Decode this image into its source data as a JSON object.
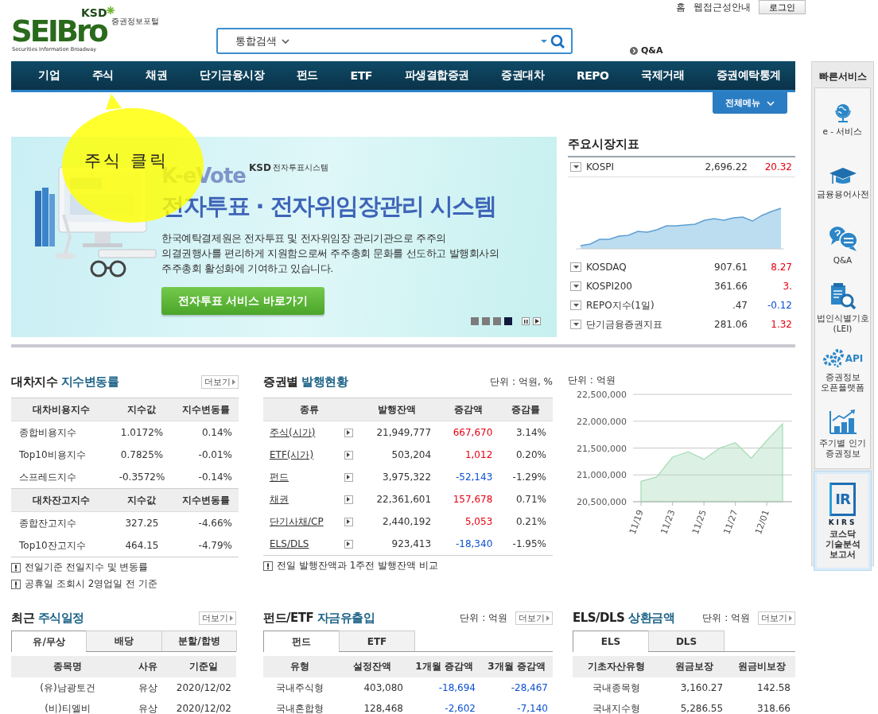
{
  "header": {
    "logo_main": "SEIBro",
    "logo_ksd": "KSD",
    "logo_portal": "증권정보포털",
    "logo_tagline": "Securities Information Broadway",
    "top_links": [
      "홈",
      "웹접근성안내"
    ],
    "login_button": "로그인",
    "search": {
      "scope": "통합검색"
    },
    "qna_link": "Q&A"
  },
  "nav": {
    "items": [
      "기업",
      "주식",
      "채권",
      "단기금융시장",
      "펀드",
      "ETF",
      "파생결합증권",
      "증권대차",
      "REPO",
      "국제거래",
      "증권예탁통계"
    ],
    "all_menu": "전체메뉴"
  },
  "callout": {
    "text": "주식 클릭"
  },
  "banner": {
    "brand": "K-eVote",
    "ksd": "KSD",
    "system": "전자투표시스템",
    "title": "전자투표 · 전자위임장관리 시스템",
    "body_lines": [
      "한국예탁결제원은 전자투표 및 전자위임장 관리기관으로 주주의",
      "의결권행사를 편리하게 지원함으로써 주주총회 문화를 선도하고 발행회사의",
      "주주총회 활성화에 기여하고 있습니다."
    ],
    "button": "전자투표 서비스 바로가기",
    "pager": [
      {
        "selected": false
      },
      {
        "selected": false
      },
      {
        "selected": false
      },
      {
        "selected": true
      }
    ]
  },
  "market": {
    "title": "주요시장지표",
    "rows": [
      {
        "name": "KOSPI",
        "value": "2,696.22",
        "change": "20.32",
        "falling": false
      },
      {
        "name": "KOSDAQ",
        "value": "907.61",
        "change": "8.27",
        "falling": false
      },
      {
        "name": "KOSPI200",
        "value": "361.66",
        "change": "3.",
        "falling": false
      },
      {
        "name": "REPO지수(1일)",
        "value": ".47",
        "change": "-0.12",
        "falling": true
      },
      {
        "name": "단기금융증권지표",
        "value": "281.06",
        "change": "1.32",
        "falling": false
      }
    ]
  },
  "lending": {
    "title_plain": "대차지수",
    "title_accent": "지수변동률",
    "more": "더보기",
    "groups": [
      {
        "columns": [
          "대차비용지수",
          "지수값",
          "지수변동률"
        ],
        "rows": [
          [
            "종합비용지수",
            "1.0172%",
            "0.14%"
          ],
          [
            "Top10비용지수",
            "0.7825%",
            "-0.01%"
          ],
          [
            "스프레드지수",
            "-0.3572%",
            "-0.14%"
          ]
        ]
      },
      {
        "columns": [
          "대차잔고지수",
          "지수값",
          "지수변동률"
        ],
        "rows": [
          [
            "종합잔고지수",
            "327.25",
            "-4.66%"
          ],
          [
            "Top10잔고지수",
            "464.15",
            "-4.79%"
          ]
        ]
      }
    ],
    "notes": [
      "전일기준 전일지수 및 변동률",
      "공휴일 조회시 2영업일 전 기준"
    ]
  },
  "issuance": {
    "title_plain": "증권별",
    "title_accent": "발행현황",
    "unit": "단위 : 억원, %",
    "columns": [
      "종류",
      "발행잔액",
      "증감액",
      "증감률"
    ],
    "rows": [
      {
        "name": "주식(시가)",
        "balance": "21,949,777",
        "change": "667,670",
        "rate": "3.14%",
        "falling": false
      },
      {
        "name": "ETF(시가)",
        "balance": "503,204",
        "change": "1,012",
        "rate": "0.20%",
        "falling": false
      },
      {
        "name": "펀드",
        "balance": "3,975,322",
        "change": "-52,143",
        "rate": "-1.29%",
        "falling": true
      },
      {
        "name": "채권",
        "balance": "22,361,601",
        "change": "157,678",
        "rate": "0.71%",
        "falling": false
      },
      {
        "name": "단기사채/CP",
        "balance": "2,440,192",
        "change": "5,053",
        "rate": "0.21%",
        "falling": false
      },
      {
        "name": "ELS/DLS",
        "balance": "923,413",
        "change": "-18,340",
        "rate": "-1.95%",
        "falling": true
      }
    ],
    "note": "전일 발행잔액과 1주전 발행잔액 비교"
  },
  "issuance_chart": {
    "unit": "단위 : 억원",
    "chart_data": {
      "type": "area",
      "categories": [
        "11/19",
        null,
        "11/23",
        null,
        "11/25",
        null,
        "11/27",
        null,
        "12/01",
        null
      ],
      "series": [
        {
          "color": "#a8dcb8",
          "values": [
            20880000,
            20960000,
            21330000,
            21430000,
            21290000,
            21500000,
            21600000,
            21310000,
            21640000,
            21950000
          ]
        }
      ],
      "ylim": [
        20500000,
        22500000
      ],
      "grid": true,
      "yticks": [
        {
          "value": 20500000,
          "label": "20,500,000"
        },
        {
          "value": 21000000,
          "label": "21,000,000"
        },
        {
          "value": 21500000,
          "label": "21,500,000"
        },
        {
          "value": 22000000,
          "label": "22,000,000"
        },
        {
          "value": 22500000,
          "label": "22,500,000"
        }
      ]
    }
  },
  "quick_service": {
    "title": "빠른서비스",
    "items": [
      {
        "kind": "globe",
        "label_lines": [
          "e - 서비스"
        ],
        "highlighted": false
      },
      {
        "kind": "cap",
        "label_lines": [
          "금융용어사전"
        ],
        "highlighted": false
      },
      {
        "kind": "qna",
        "label_lines": [
          "Q&A"
        ],
        "highlighted": false
      },
      {
        "kind": "lei",
        "label_lines": [
          "법인식별기호",
          "(LEI)"
        ],
        "highlighted": false
      },
      {
        "kind": "api",
        "badge": "API",
        "label_lines": [
          "증권정보",
          "오픈플랫폼"
        ],
        "highlighted": false
      },
      {
        "kind": "trend",
        "label_lines": [
          "주기별 인기",
          "증권정보"
        ],
        "highlighted": false
      },
      {
        "kind": "kirs",
        "logo": "IR",
        "badge": "KIRS",
        "label_lines": [
          "코스닥",
          "기술분석",
          "보고서"
        ],
        "highlighted": true
      }
    ]
  },
  "schedule": {
    "title_plain": "최근",
    "title_accent": "주식일정",
    "more": "더보기",
    "tabs": [
      {
        "label": "유/무상",
        "selected": true
      },
      {
        "label": "배당",
        "selected": false
      },
      {
        "label": "분할/합병",
        "selected": false
      }
    ],
    "columns": [
      "종목명",
      "사유",
      "기준일"
    ],
    "rows": [
      {
        "cells": [
          "(유)남광토건",
          "유상",
          "2020/12/02"
        ]
      },
      {
        "cells": [
          "(비)티엘비",
          "유상",
          "2020/12/02"
        ]
      }
    ]
  },
  "fund_flow": {
    "title_plain": "펀드/ETF",
    "title_accent": "자금유출입",
    "unit": "단위 : 억원",
    "more": "더보기",
    "tabs": [
      {
        "label": "펀드",
        "selected": true
      },
      {
        "label": "ETF",
        "selected": false
      }
    ],
    "columns": [
      "유형",
      "설정잔액",
      "1개월 증감액",
      "3개월 증감액"
    ],
    "rows": [
      {
        "cells": [
          "국내주식형",
          "403,080",
          "-18,694",
          "-28,467"
        ],
        "changes_falling": [
          true,
          true
        ]
      },
      {
        "cells": [
          "국내혼합형",
          "128,468",
          "-2,602",
          "-7,140"
        ],
        "changes_falling": [
          true,
          true
        ]
      }
    ]
  },
  "els": {
    "title_plain": "ELS/DLS",
    "title_accent": "상환금액",
    "unit": "단위 : 억원",
    "more": "더보기",
    "tabs": [
      {
        "label": "ELS",
        "selected": true
      },
      {
        "label": "DLS",
        "selected": false
      }
    ],
    "columns": [
      "기초자산유형",
      "원금보장",
      "원금비보장"
    ],
    "rows": [
      {
        "cells": [
          "국내종목형",
          "3,160.27",
          "142.58"
        ]
      },
      {
        "cells": [
          "국내지수형",
          "5,286.55",
          "318.66"
        ]
      }
    ]
  }
}
